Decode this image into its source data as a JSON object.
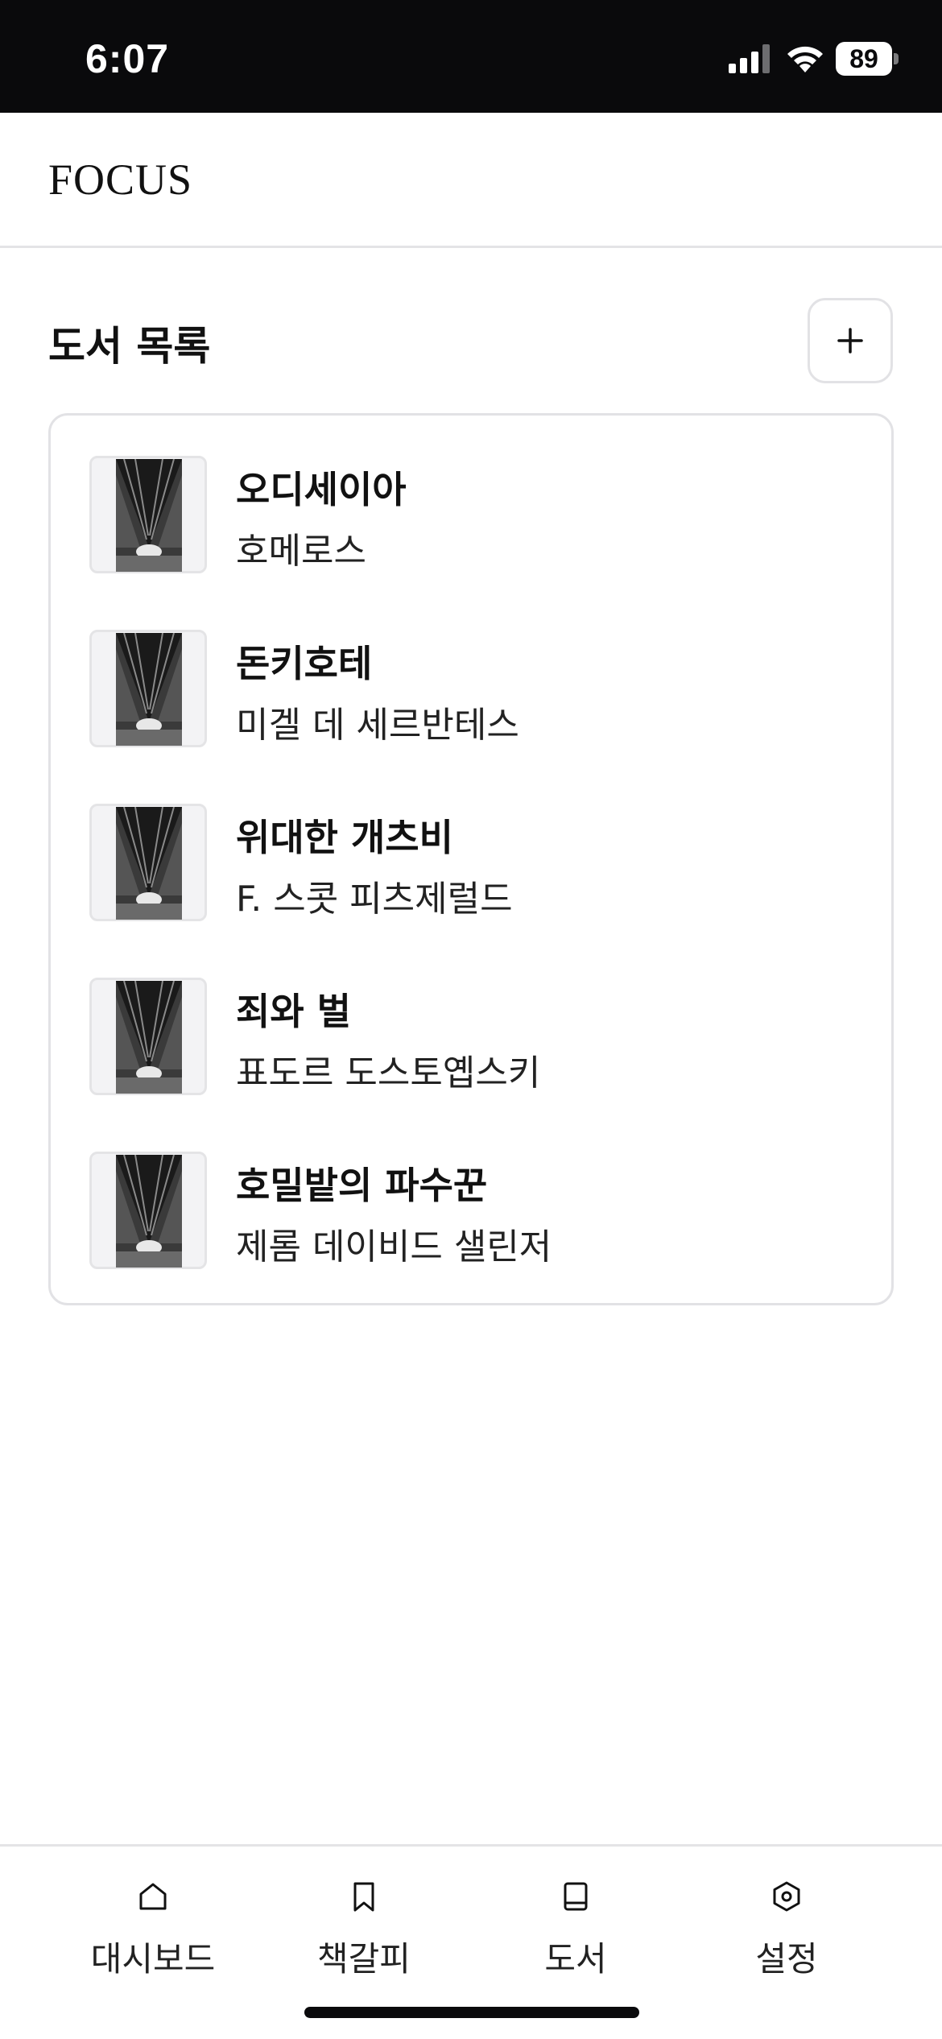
{
  "status_bar": {
    "time": "6:07",
    "battery_level": "89",
    "signal_icon": "cellular-signal-icon",
    "wifi_icon": "wifi-icon",
    "battery_icon": "battery-icon"
  },
  "header": {
    "brand": "FOCUS"
  },
  "main": {
    "section_title": "도서 목록",
    "add_button": {
      "label": "+",
      "icon": "plus-icon"
    },
    "books": [
      {
        "title": "오디세이아",
        "author": "호메로스"
      },
      {
        "title": "돈키호테",
        "author": "미겔 데 세르반테스"
      },
      {
        "title": "위대한 개츠비",
        "author": "F. 스콧 피츠제럴드"
      },
      {
        "title": "죄와 벌",
        "author": "표도르 도스토옙스키"
      },
      {
        "title": "호밀밭의 파수꾼",
        "author": "제롬 데이비드 샐린저"
      }
    ]
  },
  "bottom_nav": {
    "items": [
      {
        "label": "대시보드",
        "icon": "home-icon"
      },
      {
        "label": "책갈피",
        "icon": "bookmark-icon"
      },
      {
        "label": "도서",
        "icon": "book-icon"
      },
      {
        "label": "설정",
        "icon": "settings-icon"
      }
    ]
  },
  "colors": {
    "status_bar_bg": "#0a0a0c",
    "border": "#e2e2e5",
    "text": "#111111"
  }
}
